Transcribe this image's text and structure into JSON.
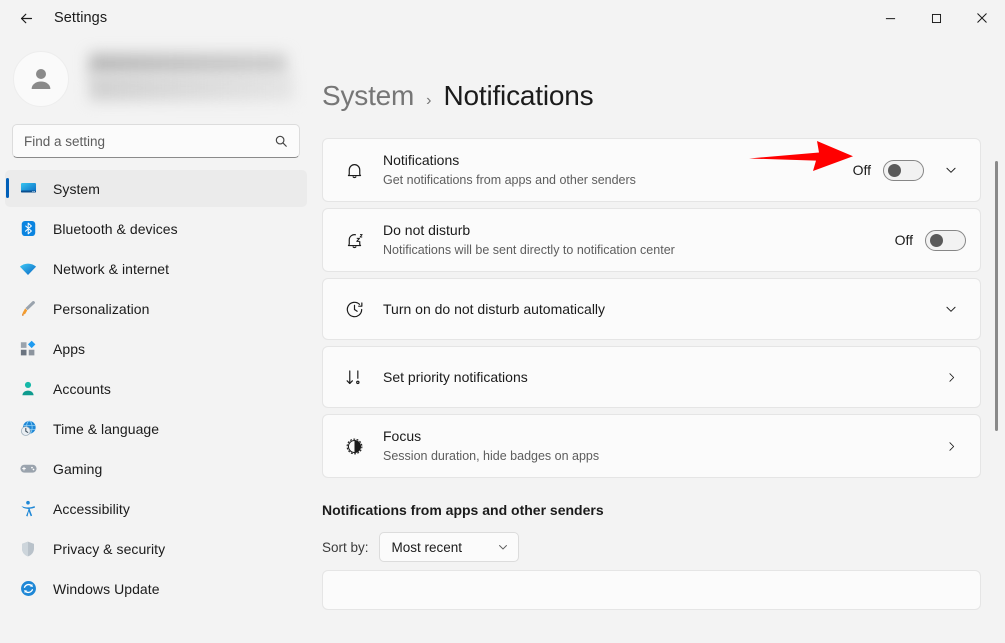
{
  "window": {
    "app_title": "Settings",
    "back_icon": "back-arrow-icon",
    "minimize_label": "—",
    "maximize_label": "□",
    "close_label": "✕"
  },
  "sidebar": {
    "search": {
      "placeholder": "Find a setting",
      "value": "",
      "icon": "search-icon"
    },
    "items": [
      {
        "label": "System",
        "icon": "monitor-icon",
        "selected": true
      },
      {
        "label": "Bluetooth & devices",
        "icon": "bluetooth-icon",
        "selected": false
      },
      {
        "label": "Network & internet",
        "icon": "wifi-icon",
        "selected": false
      },
      {
        "label": "Personalization",
        "icon": "paintbrush-icon",
        "selected": false
      },
      {
        "label": "Apps",
        "icon": "apps-icon",
        "selected": false
      },
      {
        "label": "Accounts",
        "icon": "person-icon",
        "selected": false
      },
      {
        "label": "Time & language",
        "icon": "clock-globe-icon",
        "selected": false
      },
      {
        "label": "Gaming",
        "icon": "gamepad-icon",
        "selected": false
      },
      {
        "label": "Accessibility",
        "icon": "accessibility-icon",
        "selected": false
      },
      {
        "label": "Privacy & security",
        "icon": "shield-icon",
        "selected": false
      },
      {
        "label": "Windows Update",
        "icon": "update-icon",
        "selected": false
      }
    ]
  },
  "breadcrumb": {
    "parent": "System",
    "separator": "›",
    "current": "Notifications"
  },
  "cards": [
    {
      "title": "Notifications",
      "subtitle": "Get notifications from apps and other senders",
      "icon": "bell-icon",
      "state_label": "Off",
      "toggle": "off",
      "expander": "chevron-down-icon"
    },
    {
      "title": "Do not disturb",
      "subtitle": "Notifications will be sent directly to notification center",
      "icon": "bell-sleep-icon",
      "state_label": "Off",
      "toggle": "off"
    },
    {
      "title": "Turn on do not disturb automatically",
      "subtitle": "",
      "icon": "clock-arrow-icon",
      "expander": "chevron-down-icon"
    },
    {
      "title": "Set priority notifications",
      "subtitle": "",
      "icon": "priority-sort-icon",
      "navigate": "chevron-right-icon"
    },
    {
      "title": "Focus",
      "subtitle": "Session duration, hide badges on apps",
      "icon": "focus-icon",
      "navigate": "chevron-right-icon"
    }
  ],
  "apps_section": {
    "heading": "Notifications from apps and other senders",
    "sort_label": "Sort by:",
    "sort_value": "Most recent",
    "sort_chevron": "chevron-down-icon"
  },
  "annotation": {
    "type": "red-arrow",
    "color": "#FF0000",
    "points_to": "Off"
  },
  "colors": {
    "accent": "#005FB8",
    "window_bg": "#F3F3F3",
    "card_bg": "#FBFBFB",
    "annotation_red": "#FF0000"
  }
}
